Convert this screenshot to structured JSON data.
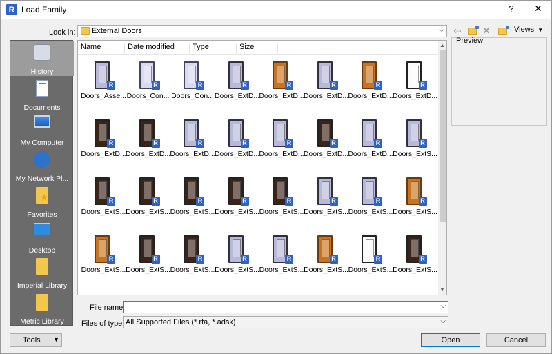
{
  "window": {
    "title": "Load Family",
    "app_icon_letter": "R",
    "help_glyph": "?",
    "close_glyph": "✕"
  },
  "lookin": {
    "label": "Look in:",
    "value": "External Doors"
  },
  "toolbar": {
    "views_label": "Views",
    "views_arrow": "▼"
  },
  "places": [
    {
      "label": "History",
      "icon": "history-icon",
      "selected": true
    },
    {
      "label": "Documents",
      "icon": "documents-icon"
    },
    {
      "label": "My Computer",
      "icon": "my-computer-icon"
    },
    {
      "label": "My Network Pl...",
      "icon": "network-places-icon"
    },
    {
      "label": "Favorites",
      "icon": "favorites-icon"
    },
    {
      "label": "Desktop",
      "icon": "desktop-icon"
    },
    {
      "label": "Imperial Library",
      "icon": "folder-icon"
    },
    {
      "label": "Metric Library",
      "icon": "folder-icon"
    }
  ],
  "list": {
    "columns": [
      "Name",
      "Date modified",
      "Type",
      "Size"
    ],
    "files": [
      {
        "name": "Doors_Asse...",
        "style": "glass2"
      },
      {
        "name": "Doors_Con...",
        "style": "glass"
      },
      {
        "name": "Doors_Con...",
        "style": "glass"
      },
      {
        "name": "Doors_ExtD...",
        "style": "glass2"
      },
      {
        "name": "Doors_ExtD...",
        "style": "wood"
      },
      {
        "name": "Doors_ExtD...",
        "style": "glass2"
      },
      {
        "name": "Doors_ExtD...",
        "style": "wood"
      },
      {
        "name": "Doors_ExtD...",
        "style": "white"
      },
      {
        "name": "Doors_ExtD...",
        "style": "dark"
      },
      {
        "name": "Doors_ExtD...",
        "style": "dark"
      },
      {
        "name": "Doors_ExtD...",
        "style": "glass2"
      },
      {
        "name": "Doors_ExtD...",
        "style": "glass2"
      },
      {
        "name": "Doors_ExtD...",
        "style": "glass2"
      },
      {
        "name": "Doors_ExtD...",
        "style": "dark"
      },
      {
        "name": "Doors_ExtD...",
        "style": "glass2"
      },
      {
        "name": "Doors_ExtS...",
        "style": "glass2"
      },
      {
        "name": "Doors_ExtS...",
        "style": "dark"
      },
      {
        "name": "Doors_ExtS...",
        "style": "dark"
      },
      {
        "name": "Doors_ExtS...",
        "style": "dark"
      },
      {
        "name": "Doors_ExtS...",
        "style": "dark"
      },
      {
        "name": "Doors_ExtS...",
        "style": "dark"
      },
      {
        "name": "Doors_ExtS...",
        "style": "glass2"
      },
      {
        "name": "Doors_ExtS...",
        "style": "glass2"
      },
      {
        "name": "Doors_ExtS...",
        "style": "wood"
      },
      {
        "name": "Doors_ExtS...",
        "style": "wood"
      },
      {
        "name": "Doors_ExtS...",
        "style": "dark"
      },
      {
        "name": "Doors_ExtS...",
        "style": "dark"
      },
      {
        "name": "Doors_ExtS...",
        "style": "glass2"
      },
      {
        "name": "Doors_ExtS...",
        "style": "glass2"
      },
      {
        "name": "Doors_ExtS...",
        "style": "wood"
      },
      {
        "name": "Doors_ExtS...",
        "style": "white"
      },
      {
        "name": "Doors_ExtS...",
        "style": "dark"
      }
    ],
    "scroll_up": "▲",
    "scroll_down": "▼"
  },
  "preview": {
    "label": "Preview"
  },
  "filename": {
    "label": "File name:",
    "value": ""
  },
  "filetype": {
    "label": "Files of type:",
    "value": "All Supported Files  (*.rfa, *.adsk)"
  },
  "buttons": {
    "tools": "Tools",
    "open": "Open",
    "cancel": "Cancel"
  },
  "glyphs": {
    "combo_arrow": "⌵",
    "back": "⇦",
    "delete": "✕",
    "badge": "R"
  }
}
